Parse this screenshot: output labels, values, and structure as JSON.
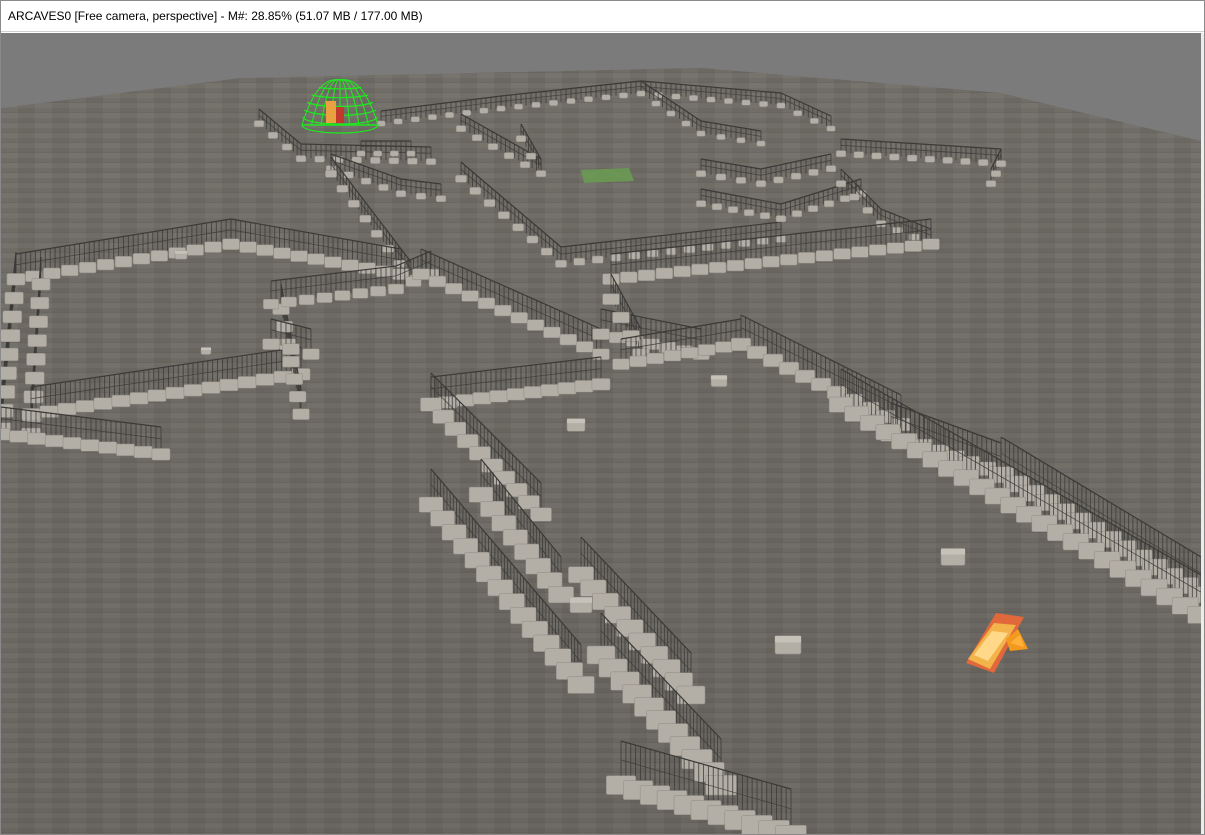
{
  "window": {
    "title": "ARCAVES0 [Free camera, perspective] - M#: 28.85% (51.07 MB / 177.00 MB)"
  },
  "viewport": {
    "icons": {
      "dome": "wireframe-dome-icon",
      "camera": "camera-gizmo-icon",
      "spawn": "spawn-marker-icon"
    },
    "colors": {
      "sky": "#7b7b7b",
      "floor": "#77736d",
      "fence": "#3b3a37",
      "block": "#b3aea6",
      "dome": "#1eea1e",
      "marker": "#6a9a52",
      "camera": "#f2b44a",
      "camera_accent": "#e0683a"
    }
  }
}
